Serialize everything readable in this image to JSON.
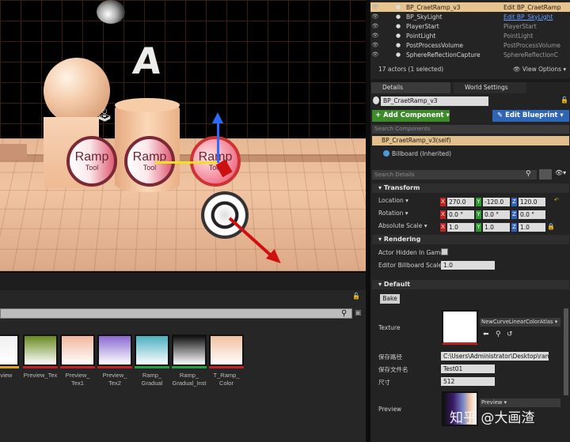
{
  "outliner": {
    "rows": [
      {
        "name": "BP_CraetRamp_v3",
        "type": "Edit BP_CraetRamp",
        "selected": true,
        "icon": "blueprint-icon"
      },
      {
        "name": "BP_SkyLight",
        "type": "Edit BP_SkyLight",
        "link": true,
        "icon": "blueprint-icon"
      },
      {
        "name": "PlayerStart",
        "type": "PlayerStart",
        "icon": "player-start-icon"
      },
      {
        "name": "PointLight",
        "type": "PointLight",
        "icon": "point-light-icon"
      },
      {
        "name": "PostProcessVolume",
        "type": "PostProcessVolume",
        "icon": "volume-icon"
      },
      {
        "name": "SphereReflectionCapture",
        "type": "SphereReflectionC",
        "icon": "sphere-icon"
      }
    ],
    "status": "17 actors (1 selected)",
    "view_options": "View Options"
  },
  "details": {
    "tab_details": "Details",
    "tab_world": "World Settings",
    "name_value": "BP_CraetRamp_v3",
    "add_component": "+ Add Component",
    "edit_blueprint": "Edit Blueprint",
    "search_components_placeholder": "Search Components",
    "component_self": "BP_CraetRamp_v3(self)",
    "component_billboard": "Billboard (Inherited)",
    "search_details_placeholder": "Search Details",
    "transform": {
      "header": "Transform",
      "location_label": "Location",
      "rotation_label": "Rotation",
      "scale_label": "Absolute Scale",
      "location": [
        "270.0",
        "-120.0",
        "120.0"
      ],
      "rotation": [
        "0.0 °",
        "0.0 °",
        "0.0 °"
      ],
      "scale": [
        "1.0",
        "1.0",
        "1.0"
      ]
    },
    "rendering": {
      "header": "Rendering",
      "actor_hidden_label": "Actor Hidden In Game",
      "billboard_scale_label": "Editor Billboard Scale",
      "billboard_scale_value": "1.0"
    },
    "default": {
      "header": "Default",
      "bake_button": "Bake",
      "texture_label": "Texture",
      "texture_asset": "NewCurveLinearColorAtlas",
      "save_path_label": "保存路径",
      "save_path_value": "C:\\Users\\Administrator\\Desktop\\ramp",
      "file_name_label": "保存文件名",
      "file_name_value": "Test01",
      "size_label": "尺寸",
      "size_value": "512",
      "preview_label": "Preview",
      "preview_asset": "Preview"
    }
  },
  "viewport": {
    "letter": "A",
    "ramp_icons": [
      {
        "line1": "Ramp",
        "line2": "Tool"
      },
      {
        "line1": "Ramp",
        "line2": "Tool"
      },
      {
        "line1": "Ramp",
        "line2": "Tool"
      }
    ]
  },
  "content_browser": {
    "assets": [
      {
        "label": "Preview",
        "top": "#f0f0f0",
        "bar": "#e0a020"
      },
      {
        "label": "Preview_Tex",
        "top": "#6a8a20",
        "bar": "#c02020"
      },
      {
        "label": "Preview_\nTex1",
        "top": "#f1b79c",
        "bar": "#c02020"
      },
      {
        "label": "Preview_\nTex2",
        "top": "#8a6ad0",
        "bar": "#c02020"
      },
      {
        "label": "Ramp_\nGradual",
        "top": "#4ab0c0",
        "bar": "#20a040"
      },
      {
        "label": "Ramp_\nGradual_Inst",
        "top": "#101010",
        "bar": "#20a040"
      },
      {
        "label": "T_Ramp_\nColor",
        "top": "#f0c0a0",
        "bar": "#c02020"
      }
    ]
  },
  "watermark": "知乎 @大画渣",
  "colors": {
    "selection": "#e2c08d",
    "add_component": "#3d8a2b",
    "edit_blueprint": "#2e66b5",
    "axis_x": "#c62020",
    "axis_y": "#2d9a2d",
    "axis_z": "#2e5fc7"
  }
}
